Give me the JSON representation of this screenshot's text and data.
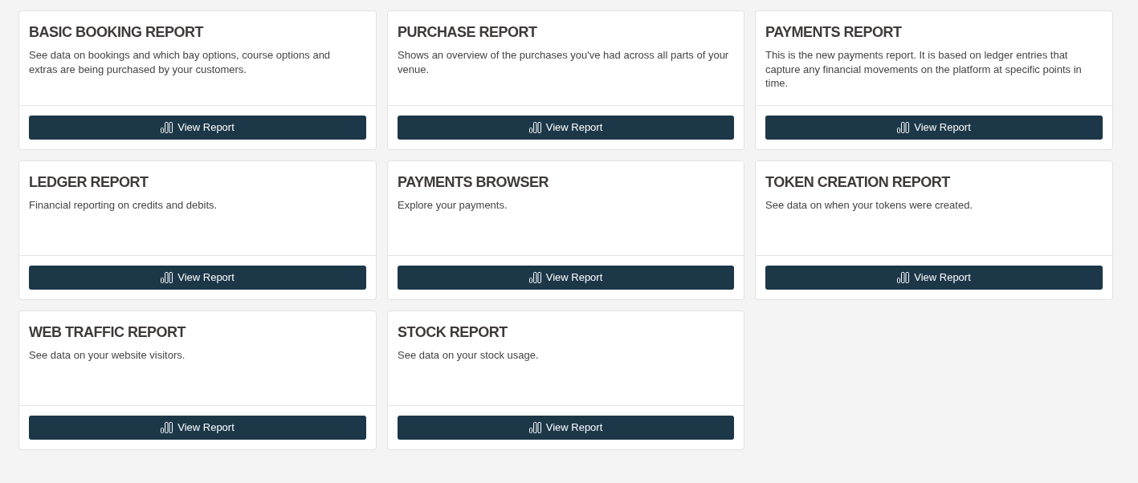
{
  "report_cards": [
    {
      "title": "BASIC BOOKING REPORT",
      "description": "See data on bookings and which bay options, course options and extras are being purchased by your customers.",
      "button": {
        "label": "View Report"
      }
    },
    {
      "title": "PURCHASE REPORT",
      "description": "Shows an overview of the purchases you've had across all parts of your venue.",
      "button": {
        "label": "View Report"
      }
    },
    {
      "title": "PAYMENTS REPORT",
      "description": "This is the new payments report. It is based on ledger entries that capture any financial movements on the platform at specific points in time.",
      "button": {
        "label": "View Report"
      }
    },
    {
      "title": "LEDGER REPORT",
      "description": "Financial reporting on credits and debits.",
      "button": {
        "label": "View Report"
      }
    },
    {
      "title": "PAYMENTS BROWSER",
      "description": "Explore your payments.",
      "button": {
        "label": "View Report"
      }
    },
    {
      "title": "TOKEN CREATION REPORT",
      "description": "See data on when your tokens were created.",
      "button": {
        "label": "View Report"
      }
    },
    {
      "title": "WEB TRAFFIC REPORT",
      "description": "See data on your website visitors.",
      "button": {
        "label": "View Report"
      }
    },
    {
      "title": "STOCK REPORT",
      "description": "See data on your stock usage.",
      "button": {
        "label": "View Report"
      }
    }
  ]
}
